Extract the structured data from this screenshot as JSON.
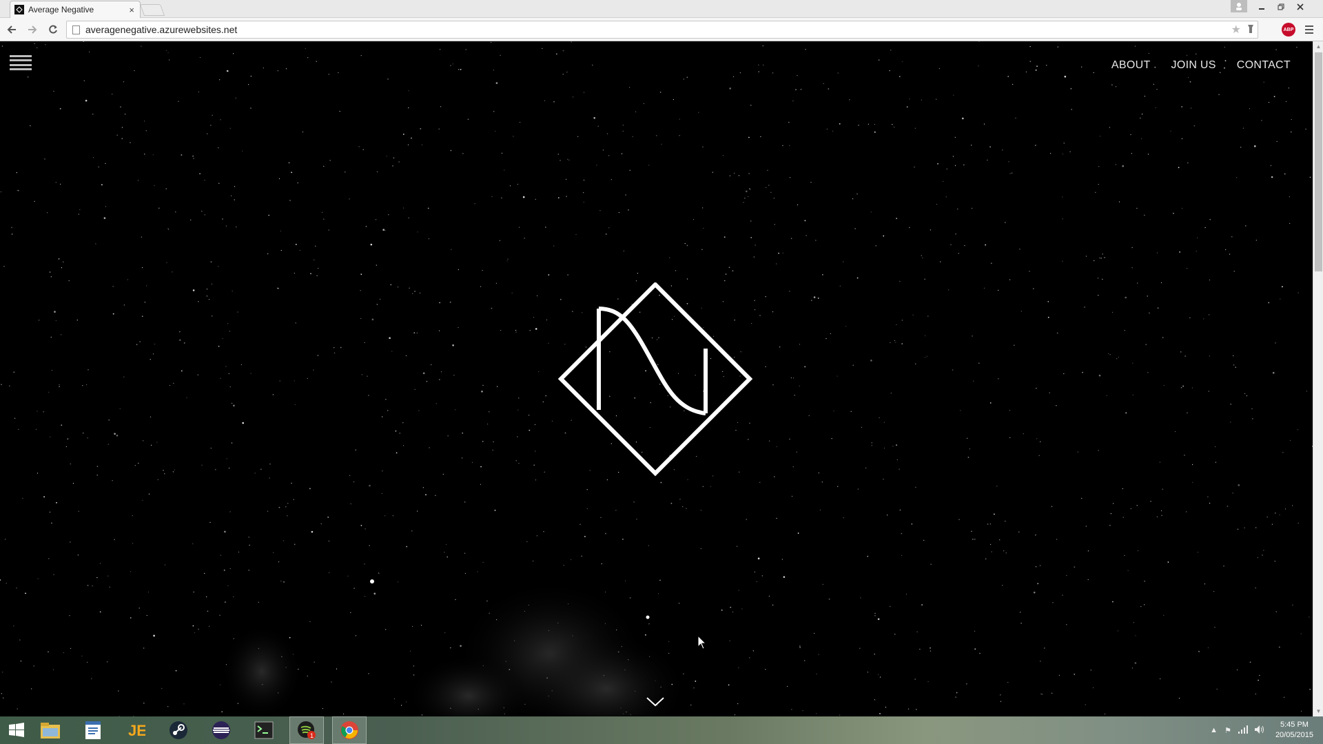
{
  "browser": {
    "tab_title": "Average Negative",
    "tab_close": "×",
    "url": "averagenegative.azurewebsites.net",
    "abp_label": "ABP"
  },
  "page": {
    "nav": [
      {
        "label": "ABOUT"
      },
      {
        "label": "JOIN US"
      },
      {
        "label": "CONTACT"
      }
    ],
    "logo_icon": "average-negative-logo-icon"
  },
  "taskbar": {
    "apps": [
      {
        "name": "file-explorer-icon"
      },
      {
        "name": "notepad-icon"
      },
      {
        "name": "jetbrains-icon"
      },
      {
        "name": "steam-icon"
      },
      {
        "name": "eclipse-icon"
      },
      {
        "name": "terminal-icon"
      },
      {
        "name": "spotify-icon"
      },
      {
        "name": "chrome-icon"
      }
    ],
    "clock_time": "5:45 PM",
    "clock_date": "20/05/2015"
  },
  "colors": {
    "page_bg": "#000000",
    "logo_stroke": "#ffffff",
    "nav_text": "#e8e8e8",
    "abp_red": "#c70d2c"
  }
}
